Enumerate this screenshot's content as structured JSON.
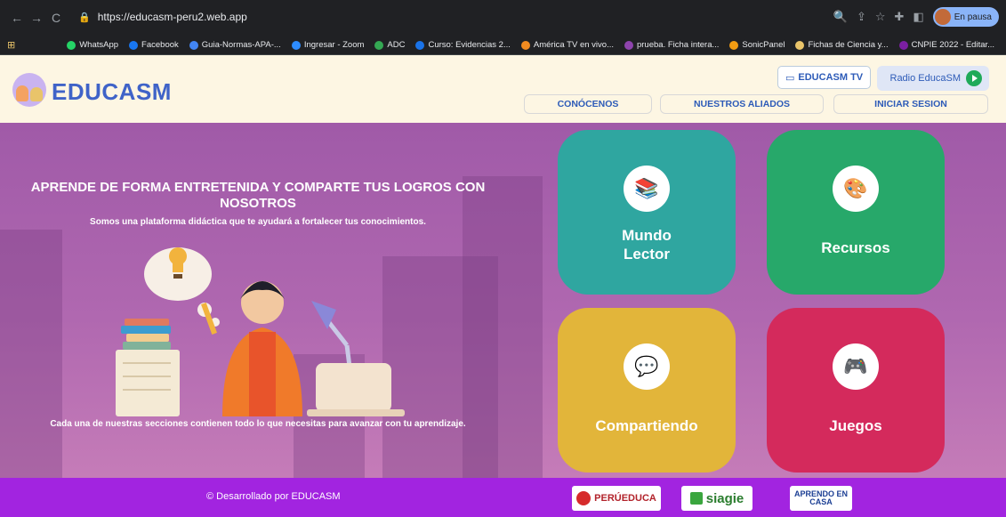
{
  "browser": {
    "url": "https://educasm-peru2.web.app",
    "profile_status": "En pausa",
    "bookmarks": [
      {
        "label": "WhatsApp",
        "color": "#25d366"
      },
      {
        "label": "Facebook",
        "color": "#1877f2"
      },
      {
        "label": "Guia-Normas-APA-...",
        "color": "#4285f4"
      },
      {
        "label": "Ingresar - Zoom",
        "color": "#2d8cff"
      },
      {
        "label": "ADC",
        "color": "#34a853"
      },
      {
        "label": "Curso: Evidencias 2...",
        "color": "#1a73e8"
      },
      {
        "label": "América TV en vivo...",
        "color": "#f28b20"
      },
      {
        "label": "prueba. Ficha intera...",
        "color": "#8e44ad"
      },
      {
        "label": "SonicPanel",
        "color": "#f39c12"
      },
      {
        "label": "Fichas de Ciencia y...",
        "color": "#e9c46a"
      },
      {
        "label": "CNPIE 2022 - Editar...",
        "color": "#7b1fa2"
      }
    ]
  },
  "header": {
    "logo_text": "EDUCASM",
    "tv_label": "EDUCASM TV",
    "radio_label": "Radio EducaSM",
    "nav": [
      "CONÓCENOS",
      "NUESTROS ALIADOS",
      "INICIAR SESION"
    ]
  },
  "hero": {
    "title": "APRENDE DE FORMA ENTRETENIDA Y COMPARTE TUS LOGROS CON NOSOTROS",
    "subtitle": "Somos una plataforma didáctica que te ayudará a fortalecer tus conocimientos.",
    "bottom_text": "Cada una de nuestras secciones contienen todo lo que necesitas para avanzar con tu aprendizaje."
  },
  "cards": [
    {
      "label": "Mundo Lector",
      "color": "#2fa6a0",
      "icon": "books-icon"
    },
    {
      "label": "Recursos",
      "color": "#27a86a",
      "icon": "resources-icon"
    },
    {
      "label": "Compartiendo",
      "color": "#e2b53a",
      "icon": "sharing-icon"
    },
    {
      "label": "Juegos",
      "color": "#d42a5c",
      "icon": "games-icon"
    }
  ],
  "footer": {
    "copyright": "© Desarrollado por EDUCASM",
    "partners": [
      "PERÚEDUCA",
      "siagie",
      "APRENDO EN CASA"
    ]
  }
}
